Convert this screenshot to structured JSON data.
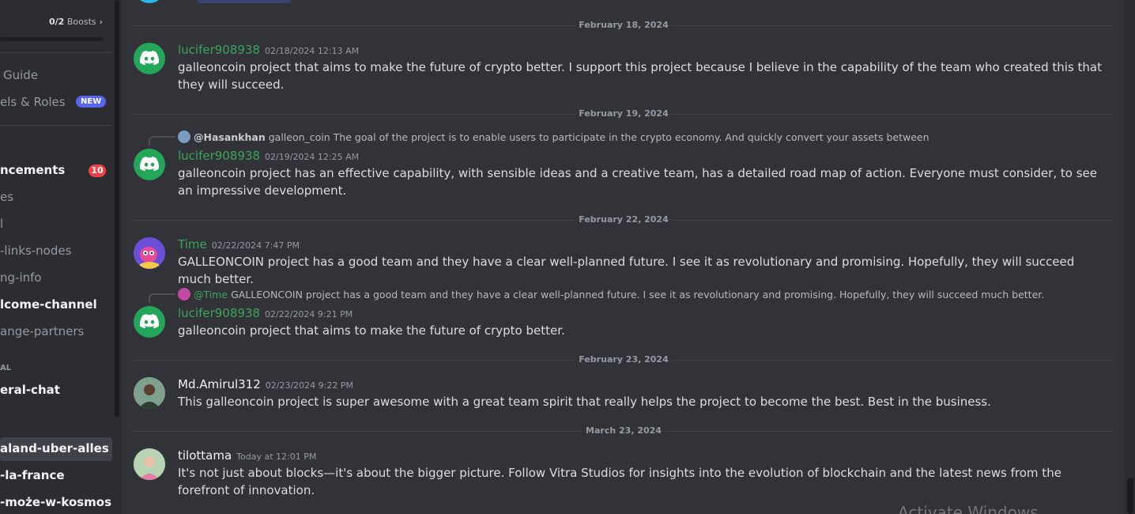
{
  "sidebar": {
    "boosts_count": "0/2",
    "boosts_label": "Boosts",
    "items": [
      {
        "label": "Guide"
      },
      {
        "label": "els & Roles",
        "badge": "NEW"
      },
      {
        "label": "ncements",
        "badge": "10"
      },
      {
        "label": "es"
      },
      {
        "label": "l"
      },
      {
        "label": "-links-nodes"
      },
      {
        "label": "ng-info"
      },
      {
        "label": "lcome-channel"
      },
      {
        "label": "ange-partners"
      },
      {
        "label": "AL"
      },
      {
        "label": "eral-chat"
      },
      {
        "label": "aland-uber-alles"
      },
      {
        "label": "-la-france"
      },
      {
        "label": "-może-w-kosmos"
      }
    ]
  },
  "messages": {
    "dates": [
      "February 18, 2024",
      "February 19, 2024",
      "February 22, 2024",
      "February 23, 2024",
      "March 23, 2024"
    ],
    "m1": {
      "author": "lucifer908938",
      "time": "02/18/2024 12:13 AM",
      "text": "galleoncoin project that aims to make the future of crypto better. I support this project because I believe in the capability of the team who created this that they will succeed."
    },
    "m2": {
      "reply_author": "@Hasankhan",
      "reply_text": "galleon_coin The goal of the project is to enable users to participate in the crypto economy. And quickly convert your assets between",
      "author": "lucifer908938",
      "time": "02/19/2024 12:25 AM",
      "text": "galleoncoin project has an effective capability, with sensible ideas and a creative team, has a detailed road map of action. Everyone must consider, to see an impressive development."
    },
    "m3": {
      "author": "Time",
      "time": "02/22/2024 7:47 PM",
      "text": "GALLEONCOIN project has a good team and they have a clear well-planned future. I see it as revolutionary and promising. Hopefully, they will succeed much better."
    },
    "m4": {
      "reply_author": "@Time",
      "reply_text": "GALLEONCOIN project has a good team and they have a clear well-planned future. I see it as revolutionary and promising. Hopefully, they will succeed much better.",
      "author": "lucifer908938",
      "time": "02/22/2024 9:21 PM",
      "text": "galleoncoin project that aims to make the future of crypto better."
    },
    "m5": {
      "author": "Md.Amirul312",
      "time": "02/23/2024 9:22 PM",
      "text": "This galleoncoin project is super awesome with a great team spirit that really helps the project to become the best. Best in the business."
    },
    "m6": {
      "author": "tilottama",
      "time": "Today at 12:01 PM",
      "text": "It's not just about blocks—it's about the bigger picture. Follow Vitra Studios for insights into the evolution of blockchain and the latest news from the forefront of innovation."
    }
  },
  "watermark": "Activate Windows",
  "colors": {
    "background": "#313338",
    "sidebar": "#2b2d31",
    "username_green": "#3ba55c",
    "accent": "#5865f2",
    "badge_red": "#f23f43"
  }
}
